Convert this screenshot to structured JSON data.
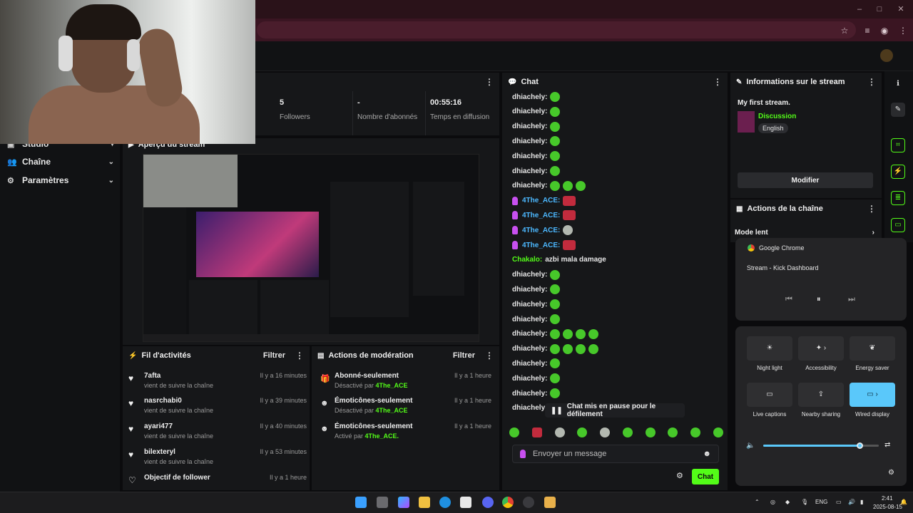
{
  "sidebar": {
    "items": [
      {
        "label": "Studio",
        "icon": "studio-icon"
      },
      {
        "label": "Chaîne",
        "icon": "users-icon"
      },
      {
        "label": "Paramètres",
        "icon": "gear-icon"
      }
    ]
  },
  "stats": [
    {
      "value": "5",
      "label": "Followers"
    },
    {
      "value": "-",
      "label": "Nombre d'abonnés"
    },
    {
      "value": "00:55:16",
      "label": "Temps en diffusion"
    }
  ],
  "preview": {
    "title": "Aperçu du stream"
  },
  "feed": {
    "title": "Fil d'activités",
    "filter_label": "Filtrer",
    "items": [
      {
        "name": "7afta",
        "sub": "vient de suivre la chaîne",
        "time": "Il y a 16 minutes"
      },
      {
        "name": "nasrchabi0",
        "sub": "vient de suivre la chaîne",
        "time": "Il y a 39 minutes"
      },
      {
        "name": "ayari477",
        "sub": "vient de suivre la chaîne",
        "time": "Il y a 40 minutes"
      },
      {
        "name": "bilexteryl",
        "sub": "vient de suivre la chaîne",
        "time": "Il y a 53 minutes"
      },
      {
        "name": "Objectif de follower",
        "sub": "",
        "time": "Il y a 1 heure"
      }
    ]
  },
  "moderation": {
    "title": "Actions de modération",
    "filter_label": "Filtrer",
    "items": [
      {
        "name": "Abonné-seulement",
        "prefix": "Désactivé par",
        "user": "4The_ACE",
        "time": "Il y a 1 heure"
      },
      {
        "name": "Émoticônes-seulement",
        "prefix": "Désactivé par",
        "user": "4The_ACE",
        "time": "Il y a 1 heure"
      },
      {
        "name": "Émoticônes-seulement",
        "prefix": "Activé par",
        "user": "4The_ACE.",
        "time": "Il y a 1 heure"
      }
    ]
  },
  "chat": {
    "title": "Chat",
    "lines": [
      {
        "user": "dhiachely:",
        "type": "default",
        "emotes": [
          "green"
        ]
      },
      {
        "user": "dhiachely:",
        "type": "default",
        "emotes": [
          "green"
        ]
      },
      {
        "user": "dhiachely:",
        "type": "default",
        "emotes": [
          "green"
        ]
      },
      {
        "user": "dhiachely:",
        "type": "default",
        "emotes": [
          "green"
        ]
      },
      {
        "user": "dhiachely:",
        "type": "default",
        "emotes": [
          "green"
        ]
      },
      {
        "user": "dhiachely:",
        "type": "default",
        "emotes": [
          "green"
        ]
      },
      {
        "user": "dhiachely:",
        "type": "default",
        "emotes": [
          "green",
          "green",
          "green"
        ]
      },
      {
        "user": "4The_ACE:",
        "type": "purple",
        "emotes": [
          "red"
        ]
      },
      {
        "user": "4The_ACE:",
        "type": "purple",
        "emotes": [
          "red"
        ]
      },
      {
        "user": "4The_ACE:",
        "type": "purple",
        "emotes": [
          "grey"
        ]
      },
      {
        "user": "4The_ACE:",
        "type": "purple",
        "emotes": [
          "red"
        ]
      },
      {
        "user": "Chakalo:",
        "type": "green",
        "message": "azbi mala damage"
      },
      {
        "user": "dhiachely:",
        "type": "default",
        "emotes": [
          "green"
        ]
      },
      {
        "user": "dhiachely:",
        "type": "default",
        "emotes": [
          "green"
        ]
      },
      {
        "user": "dhiachely:",
        "type": "default",
        "emotes": [
          "green"
        ]
      },
      {
        "user": "dhiachely:",
        "type": "default",
        "emotes": [
          "green"
        ]
      },
      {
        "user": "dhiachely:",
        "type": "default",
        "emotes": [
          "green",
          "green",
          "green",
          "green"
        ]
      },
      {
        "user": "dhiachely:",
        "type": "default",
        "emotes": [
          "green",
          "green",
          "green",
          "green"
        ]
      },
      {
        "user": "dhiachely:",
        "type": "default",
        "emotes": [
          "green"
        ]
      },
      {
        "user": "dhiachely:",
        "type": "default",
        "emotes": [
          "green"
        ]
      },
      {
        "user": "dhiachely:",
        "type": "default",
        "emotes": [
          "green"
        ]
      },
      {
        "user": "dhiachely:",
        "type": "default",
        "emotes": [
          "green"
        ]
      }
    ],
    "pause_notice": "Chat mis en pause pour le défilement",
    "input_placeholder": "Envoyer un message",
    "send_label": "Chat"
  },
  "stream_info": {
    "title": "Informations sur le stream",
    "stream_title": "My first stream.",
    "category": "Discussion",
    "language": "English",
    "edit_label": "Modifier"
  },
  "channel_actions": {
    "title": "Actions de la chaîne",
    "first_action": "Mode lent"
  },
  "media_popup": {
    "app": "Google Chrome",
    "title": "Stream - Kick Dashboard"
  },
  "quick_settings": {
    "tiles": [
      {
        "label": "Night light",
        "icon": "sun-icon",
        "on": false
      },
      {
        "label": "Accessibility",
        "icon": "accessibility-icon",
        "on": false
      },
      {
        "label": "Energy saver",
        "icon": "leaf-icon",
        "on": false
      },
      {
        "label": "Live captions",
        "icon": "captions-icon",
        "on": false
      },
      {
        "label": "Nearby sharing",
        "icon": "share-icon",
        "on": false
      },
      {
        "label": "Wired display",
        "icon": "display-icon",
        "on": true
      }
    ],
    "volume": 0.84
  },
  "taskbar": {
    "lang": "ENG",
    "time": "2:41",
    "date": "2025-08-15"
  },
  "colors": {
    "accent": "#53fc18",
    "qs_accent": "#5ac8fa",
    "browser": "#3a1522"
  }
}
